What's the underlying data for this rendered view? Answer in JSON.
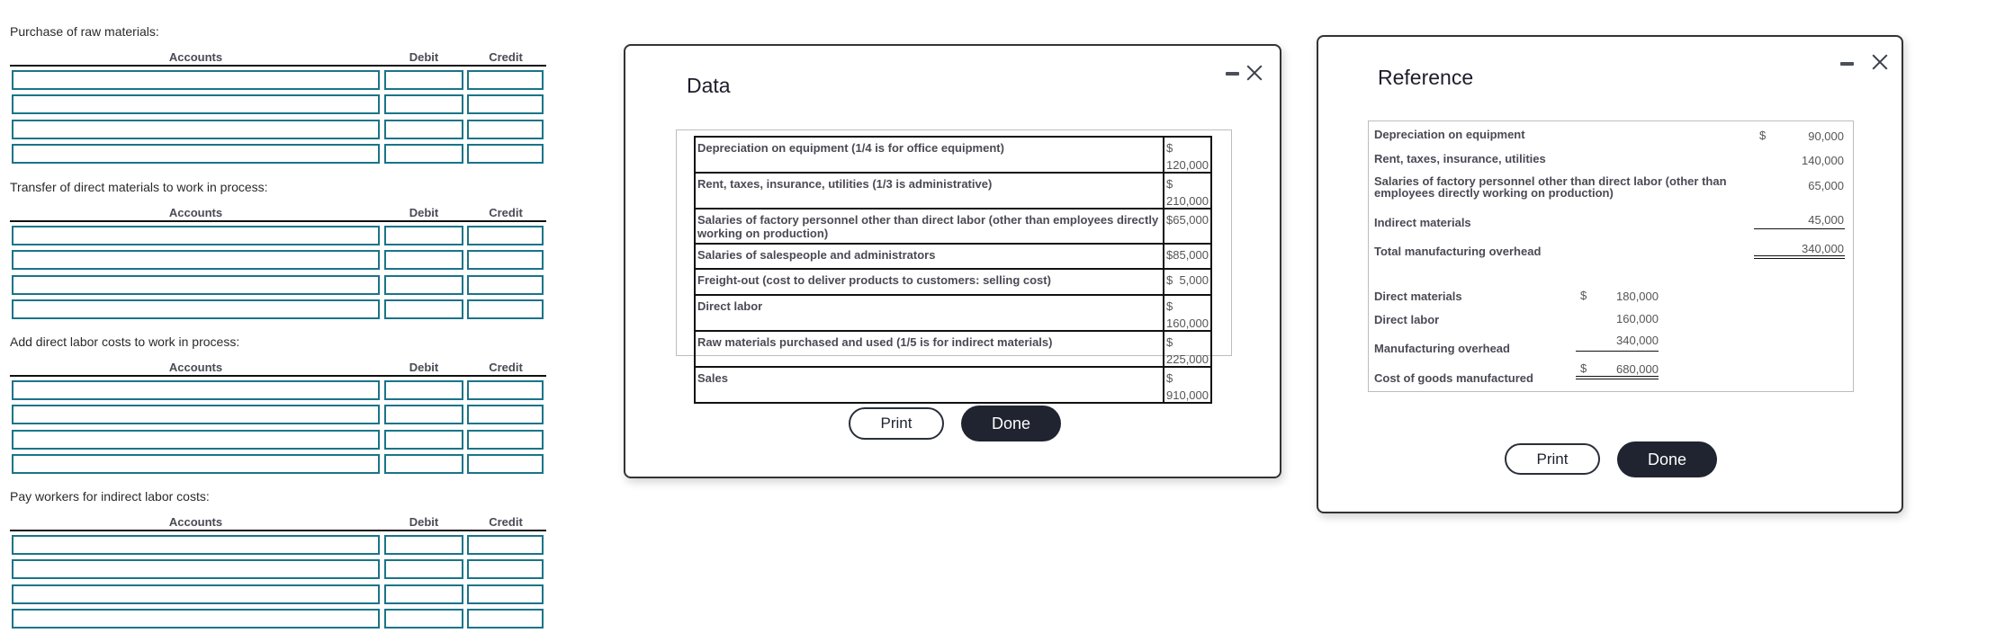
{
  "journal": {
    "columns": {
      "accounts": "Accounts",
      "debit": "Debit",
      "credit": "Credit"
    },
    "sections": [
      {
        "title": "Purchase of raw materials:",
        "rows": [
          {
            "account": "",
            "debit": "",
            "credit": ""
          },
          {
            "account": "",
            "debit": "",
            "credit": ""
          },
          {
            "account": "",
            "debit": "",
            "credit": ""
          },
          {
            "account": "",
            "debit": "",
            "credit": ""
          }
        ]
      },
      {
        "title": "Transfer of direct materials to work in process:",
        "rows": [
          {
            "account": "",
            "debit": "",
            "credit": ""
          },
          {
            "account": "",
            "debit": "",
            "credit": ""
          },
          {
            "account": "",
            "debit": "",
            "credit": ""
          },
          {
            "account": "",
            "debit": "",
            "credit": ""
          }
        ]
      },
      {
        "title": "Add direct labor costs to work in process:",
        "rows": [
          {
            "account": "",
            "debit": "",
            "credit": ""
          },
          {
            "account": "",
            "debit": "",
            "credit": ""
          },
          {
            "account": "",
            "debit": "",
            "credit": ""
          },
          {
            "account": "",
            "debit": "",
            "credit": ""
          }
        ]
      },
      {
        "title": "Pay workers for indirect labor costs:",
        "rows": [
          {
            "account": "",
            "debit": "",
            "credit": ""
          },
          {
            "account": "",
            "debit": "",
            "credit": ""
          },
          {
            "account": "",
            "debit": "",
            "credit": ""
          },
          {
            "account": "",
            "debit": "",
            "credit": ""
          }
        ]
      }
    ]
  },
  "data_dialog": {
    "title": "Data",
    "minimize_icon": "minimize-icon",
    "close_icon": "close-icon",
    "rows": [
      {
        "label": "Depreciation on equipment (1/4 is for office equipment)",
        "currency": "$",
        "amount": "120,000"
      },
      {
        "label": "Rent, taxes, insurance, utilities (1/3 is administrative)",
        "currency": "$",
        "amount": "210,000"
      },
      {
        "label": "Salaries of factory personnel other than direct labor (other than employees directly working on production)",
        "currency": "$",
        "amount": "65,000"
      },
      {
        "label": "Salaries of salespeople and administrators",
        "currency": "$",
        "amount": "85,000"
      },
      {
        "label": "Freight-out (cost to deliver products to customers: selling cost)",
        "currency": "$",
        "amount": "5,000"
      },
      {
        "label": "Direct labor",
        "currency": "$",
        "amount": "160,000"
      },
      {
        "label": "Raw materials purchased and used (1/5 is for indirect materials)",
        "currency": "$",
        "amount": "225,000"
      },
      {
        "label": "Sales",
        "currency": "$",
        "amount": "910,000"
      }
    ],
    "print_label": "Print",
    "done_label": "Done"
  },
  "reference_dialog": {
    "title": "Reference",
    "minimize_icon": "minimize-icon",
    "close_icon": "close-icon",
    "overhead": [
      {
        "label": "Depreciation on equipment",
        "currency": "$",
        "amount": "90,000"
      },
      {
        "label": "Rent, taxes, insurance, utilities",
        "currency": "",
        "amount": "140,000"
      },
      {
        "label": "Salaries of factory personnel other than direct labor (other than employees directly working on production)",
        "currency": "",
        "amount": "65,000"
      },
      {
        "label": "Indirect materials",
        "currency": "",
        "amount": "45,000"
      },
      {
        "label": "Total manufacturing overhead",
        "currency": "",
        "amount": "340,000"
      }
    ],
    "cogm": [
      {
        "label": "Direct materials",
        "currency": "$",
        "amount": "180,000"
      },
      {
        "label": "Direct labor",
        "currency": "",
        "amount": "160,000"
      },
      {
        "label": "Manufacturing overhead",
        "currency": "",
        "amount": "340,000"
      },
      {
        "label": "Cost of goods manufactured",
        "currency": "$",
        "amount": "680,000"
      }
    ],
    "print_label": "Print",
    "done_label": "Done"
  },
  "colors": {
    "input_border": "#1a7488",
    "done_button": "#1f2430"
  }
}
